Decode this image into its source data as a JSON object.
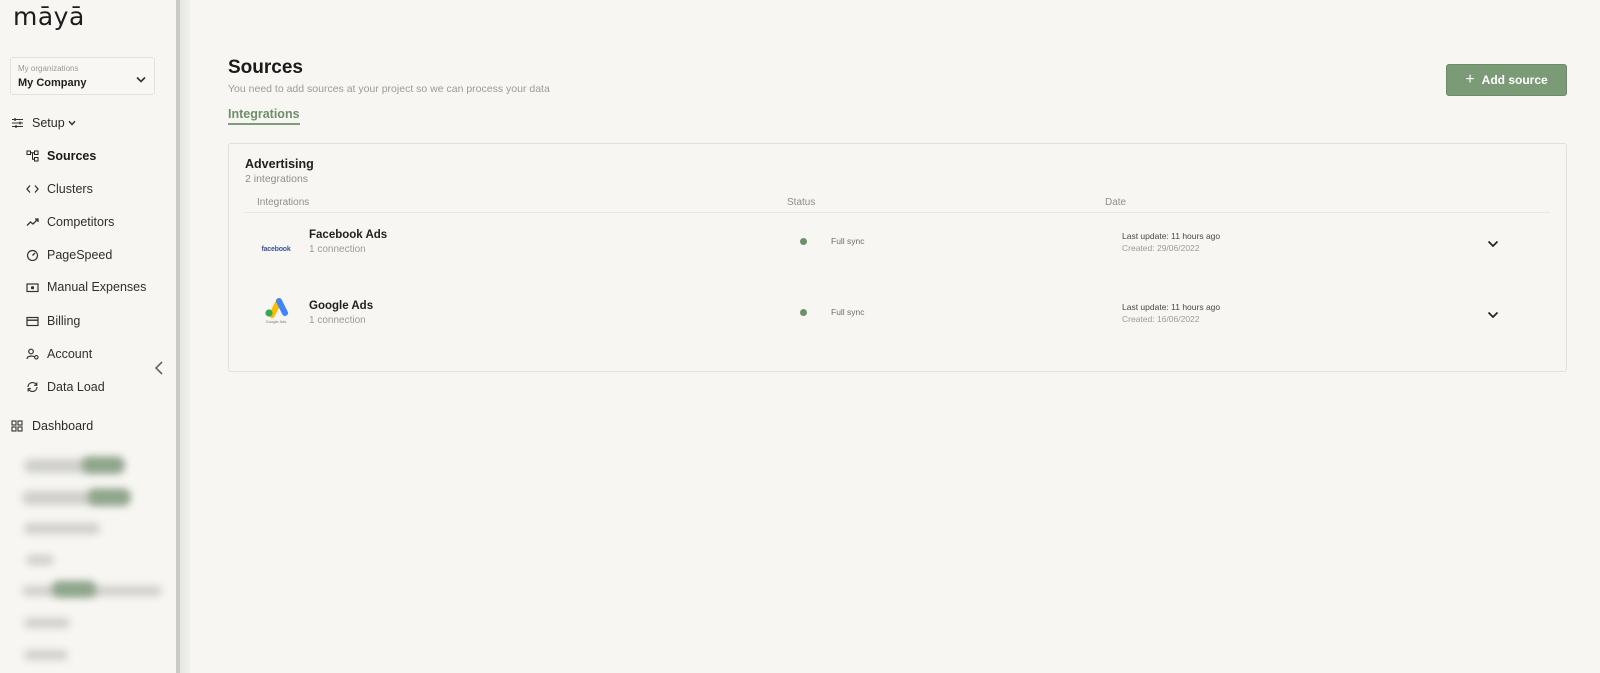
{
  "brand": {
    "logo_text": "māyā",
    "accent": "#7a9b76"
  },
  "org": {
    "caption": "My organizations",
    "name": "My Company"
  },
  "nav": {
    "setup_label": "Setup",
    "items": [
      {
        "label": "Sources",
        "icon": "sources-icon",
        "active": true
      },
      {
        "label": "Clusters",
        "icon": "code-icon"
      },
      {
        "label": "Competitors",
        "icon": "trend-icon"
      },
      {
        "label": "PageSpeed",
        "icon": "gauge-icon"
      },
      {
        "label": "Manual Expenses",
        "icon": "cash-icon"
      },
      {
        "label": "Billing",
        "icon": "card-icon"
      },
      {
        "label": "Account",
        "icon": "user-gear-icon"
      },
      {
        "label": "Data Load",
        "icon": "sync-icon"
      }
    ],
    "dashboard_label": "Dashboard"
  },
  "page": {
    "title": "Sources",
    "subtitle": "You need to add sources at your project so we can process your data",
    "tab": "Integrations",
    "add_button": "Add source"
  },
  "card": {
    "title": "Advertising",
    "subtitle": "2 integrations",
    "columns": [
      "Integrations",
      "Status",
      "Date"
    ],
    "rows": [
      {
        "name": "Facebook Ads",
        "connections": "1 connection",
        "logo_text": "facebook",
        "status": "Full sync",
        "last_update": "Last update: 11 hours ago",
        "created": "Created: 29/06/2022"
      },
      {
        "name": "Google Ads",
        "connections": "1 connection",
        "logo_text": "Google Ads",
        "status": "Full sync",
        "last_update": "Last update: 11 hours ago",
        "created": "Created: 16/06/2022"
      }
    ]
  }
}
